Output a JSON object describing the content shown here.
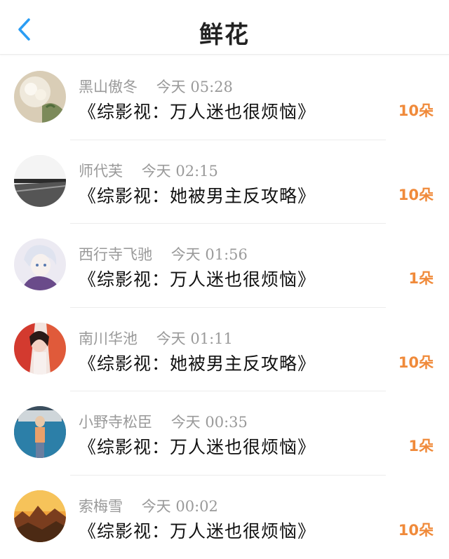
{
  "header": {
    "title": "鲜花"
  },
  "rows": [
    {
      "user": "黑山傲冬",
      "time": "今天 05:28",
      "book": "《综影视：万人迷也很烦恼》",
      "count": "10朵"
    },
    {
      "user": "师代芙",
      "time": "今天 02:15",
      "book": "《综影视：她被男主反攻略》",
      "count": "10朵"
    },
    {
      "user": "西行寺飞驰",
      "time": "今天 01:56",
      "book": "《综影视：万人迷也很烦恼》",
      "count": "1朵"
    },
    {
      "user": "南川华池",
      "time": "今天 01:11",
      "book": "《综影视：她被男主反攻略》",
      "count": "10朵"
    },
    {
      "user": "小野寺松臣",
      "time": "今天 00:35",
      "book": "《综影视：万人迷也很烦恼》",
      "count": "1朵"
    },
    {
      "user": "索梅雪",
      "time": "今天 00:02",
      "book": "《综影视：万人迷也很烦恼》",
      "count": "10朵"
    }
  ],
  "colors": {
    "accent": "#f08a3a",
    "back_icon": "#2a9df4",
    "meta": "#9a9a9a"
  },
  "icons": {
    "back": "chevron-left-icon"
  }
}
